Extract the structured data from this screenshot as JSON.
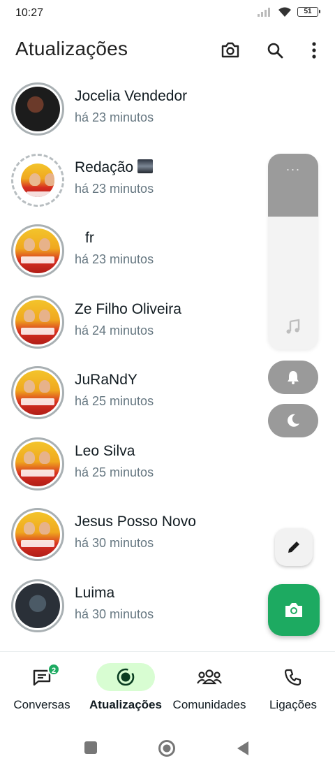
{
  "status_bar": {
    "time": "10:27",
    "battery": "51"
  },
  "header": {
    "title": "Atualizações"
  },
  "statuses": [
    {
      "name": "Jocelia Vendedor",
      "time": "há 23 minutos"
    },
    {
      "name": "Redação",
      "time": "há 23 minutos"
    },
    {
      "name": "fr",
      "time": "há 23 minutos"
    },
    {
      "name": "Ze Filho Oliveira",
      "time": "há 24 minutos"
    },
    {
      "name": "JuRaNdY",
      "time": "há 25 minutos"
    },
    {
      "name": "Leo Silva",
      "time": "há 25 minutos"
    },
    {
      "name": "Jesus Posso Novo",
      "time": "há 30 minutos"
    },
    {
      "name": "Luima",
      "time": "há 30 minutos"
    }
  ],
  "volume_overlay": {
    "level": 0.67,
    "more_label": "···"
  },
  "bottom_nav": {
    "items": [
      {
        "label": "Conversas",
        "badge": "2"
      },
      {
        "label": "Atualizações"
      },
      {
        "label": "Comunidades"
      },
      {
        "label": "Ligações"
      }
    ]
  },
  "colors": {
    "accent": "#1daa61",
    "active_tab_bg": "#d8fdd2"
  },
  "icons": [
    "camera-icon",
    "search-icon",
    "more-vert-icon",
    "music-note-icon",
    "bell-icon",
    "moon-icon",
    "pencil-icon",
    "chat-icon",
    "status-icon",
    "communities-icon",
    "phone-icon"
  ]
}
